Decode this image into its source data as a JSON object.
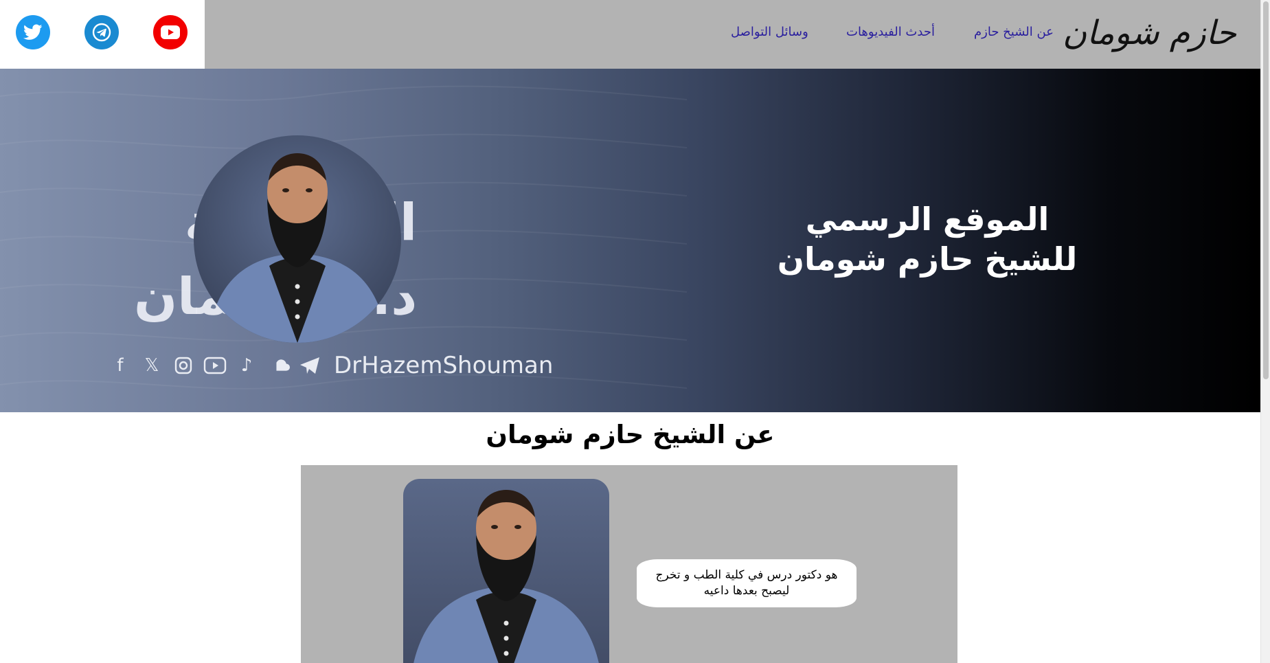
{
  "header": {
    "logo": "حازم شومان",
    "nav": {
      "about": "عن الشيخ حازم",
      "latest_videos": "أحدث الفيديوهات",
      "contact": "وسائل التواصل"
    },
    "social": {
      "twitter_icon": "twitter-icon",
      "telegram_icon": "telegram-icon",
      "youtube_icon": "youtube-icon"
    }
  },
  "hero": {
    "title_line1": "الموقع الرسمي",
    "title_line2": "للشيخ حازم شومان",
    "banner_text_line1": "القنـــ ـية",
    "banner_text_line2": "د.حــــ ـمان",
    "banner_handle": "DrHazemShouman",
    "banner_icons": [
      "facebook-icon",
      "x-icon",
      "instagram-icon",
      "youtube-icon",
      "tiktok-icon",
      "soundcloud-icon",
      "telegram-icon"
    ]
  },
  "about": {
    "heading": "عن الشيخ حازم شومان",
    "bio": "هو دكتور درس في كلية الطب و تخرج ليصبح بعدها داعيه"
  },
  "colors": {
    "header_bg": "#b3b3b3",
    "nav_link": "#2a1f9e",
    "twitter": "#1d9bf0",
    "telegram": "#1a8ad1",
    "youtube": "#f20000",
    "about_card_bg": "#b3b3b3"
  }
}
